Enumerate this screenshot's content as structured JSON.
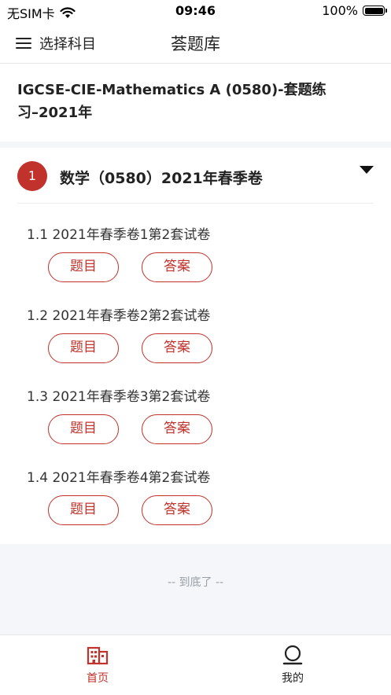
{
  "status_bar": {
    "carrier": "无SIM卡",
    "time": "09:46",
    "battery": "100%"
  },
  "nav": {
    "menu_label": "选择科目",
    "title": "荟题库"
  },
  "page_heading": "IGCSE-CIE-Mathematics A (0580)-套题练习–2021年",
  "chapter": {
    "number": "1",
    "title": "数学（0580）2021年春季卷",
    "papers": [
      {
        "title": "1.1 2021年春季卷1第2套试卷",
        "question_label": "题目",
        "answer_label": "答案"
      },
      {
        "title": "1.2 2021年春季卷2第2套试卷",
        "question_label": "题目",
        "answer_label": "答案"
      },
      {
        "title": "1.3 2021年春季卷3第2套试卷",
        "question_label": "题目",
        "answer_label": "答案"
      },
      {
        "title": "1.4 2021年春季卷4第2套试卷",
        "question_label": "题目",
        "answer_label": "答案"
      }
    ]
  },
  "end_text": "-- 到底了 --",
  "tabs": [
    {
      "label": "首页",
      "icon": "building-icon",
      "active": true
    },
    {
      "label": "我的",
      "icon": "user-icon",
      "active": false
    }
  ],
  "colors": {
    "accent": "#c0322b",
    "band": "#f4f6fa"
  }
}
